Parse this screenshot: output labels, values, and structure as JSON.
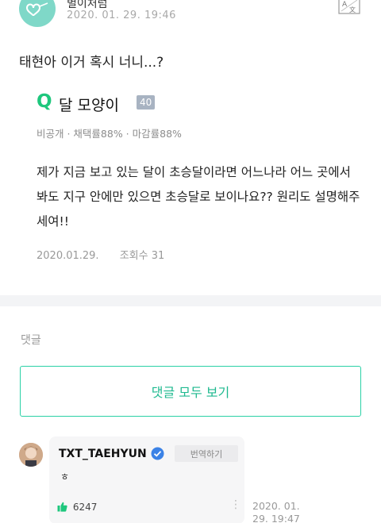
{
  "post": {
    "author": "별이처럼",
    "date": "2020. 01. 29. 19:46",
    "translate_icon": "translate-icon",
    "text": "태현아 이거 혹시 너니...?"
  },
  "question": {
    "mark": "Q",
    "title": "달 모양이",
    "points": "40",
    "meta": "비공개 · 채택률88% · 마감률88%",
    "body": "제가 지금 보고 있는 달이 초승달이라면 어느나라 어느 곳에서 봐도 지구 안에만 있으면 초승달로 보이나요?? 원리도 설명해주세여!!",
    "date": "2020.01.29.",
    "views": "조회수 31",
    "accent_color": "#1ec77d"
  },
  "comments": {
    "label": "댓글",
    "view_all": "댓글 모두 보기",
    "accent_color": "#2ad1a6",
    "items": [
      {
        "name": "TXT_TAEHYUN",
        "verified_icon": "verified-check-icon",
        "translate": "번역하기",
        "text": "ㅎ",
        "likes": "6247",
        "date": "2020. 01. 29. 19:47"
      }
    ]
  }
}
